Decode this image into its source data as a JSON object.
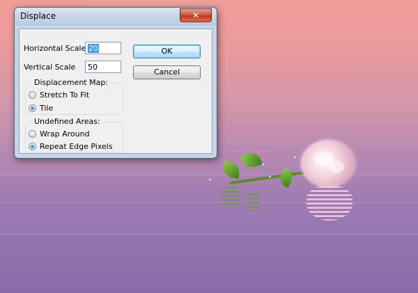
{
  "dialog": {
    "title": "Displace",
    "close_glyph": "✕",
    "fields": {
      "horizontal_scale": {
        "label": "Horizontal Scale",
        "value": "20"
      },
      "vertical_scale": {
        "label": "Vertical Scale",
        "value": "50"
      }
    },
    "buttons": {
      "ok": "OK",
      "cancel": "Cancel"
    },
    "displacement_map": {
      "title": "Displacement Map:",
      "options": [
        {
          "label": "Stretch To Fit",
          "checked": false
        },
        {
          "label": "Tile",
          "checked": true
        }
      ]
    },
    "undefined_areas": {
      "title": "Undefined Areas:",
      "options": [
        {
          "label": "Wrap Around",
          "checked": false
        },
        {
          "label": "Repeat Edge Pixels",
          "checked": true
        }
      ]
    }
  },
  "canvas": {
    "icon": "rose-image",
    "colors": {
      "sky_top": "#ef9e98",
      "water_bottom": "#8a6ba8"
    }
  }
}
